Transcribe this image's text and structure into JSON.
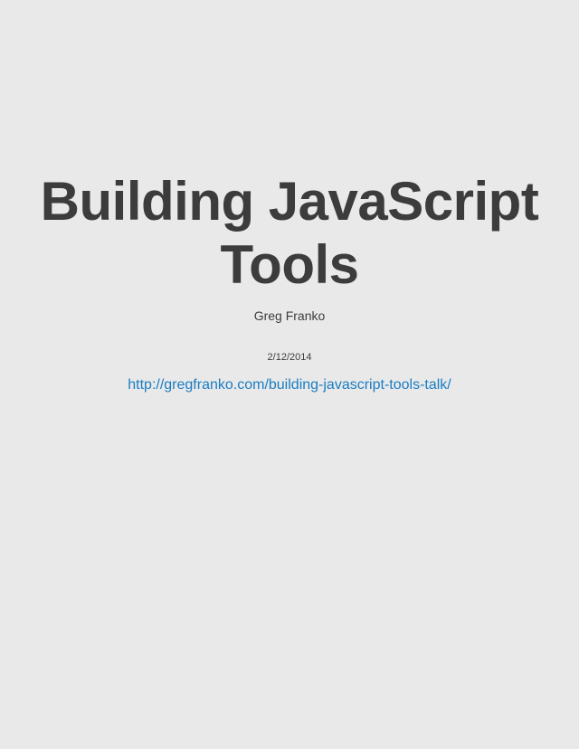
{
  "slide": {
    "title_line_1": "Building JavaScript",
    "title_line_2": "Tools",
    "author": "Greg Franko",
    "date": "2/12/2014",
    "link_text": "http://gregfranko.com/building-javascript-tools-talk/",
    "link_href": "http://gregfranko.com/building-javascript-tools-talk/"
  },
  "colors": {
    "background": "#e9e9e9",
    "text": "#3c3c3c",
    "link": "#1a7dc4"
  }
}
